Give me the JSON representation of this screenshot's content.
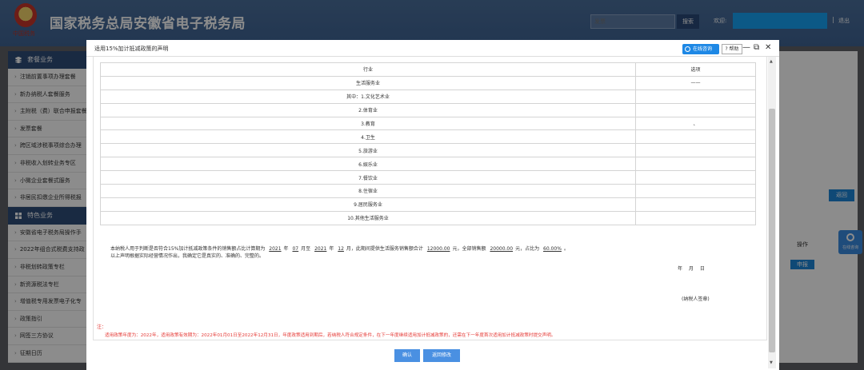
{
  "header": {
    "logo_motto": "中国税务",
    "title": "国家税务总局安徽省电子税务局",
    "search_placeholder": "发票",
    "search_button": "搜索",
    "welcome": "欢迎:",
    "separator": "|",
    "logout": "退出"
  },
  "sidebar": {
    "section1": "套餐业务",
    "section1_items": [
      "注销前置事项办理套餐",
      "新办纳税人套餐服务",
      "主附税（费）联合申报套餐",
      "发票套餐",
      "跨区域涉税事项综合办理",
      "非税收入划转业务专区",
      "小微企业套餐式服务",
      "非居民扣缴企业所得税报"
    ],
    "section2": "特色业务",
    "section2_items": [
      "安徽省电子税务局操作手",
      "2022年组合式税费支持政",
      "非税划转政策专栏",
      "新资源税法专栏",
      "增值税专用发票电子化专",
      "政策指引",
      "网签三方协议",
      "征期日历"
    ]
  },
  "background": {
    "back_button": "返回",
    "operation_header": "操作",
    "declare_button": "申报",
    "float_consult": "在线咨询"
  },
  "modal": {
    "title": "适用15%加计抵减政策的声明",
    "online_consult": "在线咨询",
    "help": "? 帮助",
    "minimize": "—",
    "restore": "⧉",
    "close": "✕",
    "table": {
      "headers": [
        "行业",
        "选项"
      ],
      "rows": [
        {
          "industry": "生活服务业",
          "option": "——"
        },
        {
          "industry": "其中：1.文化艺术业",
          "option": ""
        },
        {
          "industry": "2.体育业",
          "option": ""
        },
        {
          "industry": "3.教育",
          "option": "、"
        },
        {
          "industry": "4.卫生",
          "option": ""
        },
        {
          "industry": "5.旅游业",
          "option": ""
        },
        {
          "industry": "6.娱乐业",
          "option": ""
        },
        {
          "industry": "7.餐饮业",
          "option": ""
        },
        {
          "industry": "8.住宿业",
          "option": ""
        },
        {
          "industry": "9.居民服务业",
          "option": ""
        },
        {
          "industry": "10.其他生活服务业",
          "option": ""
        }
      ]
    },
    "statement": {
      "p1": "本纳税人用于判断是否符合15%加计抵减政策条件的销售额占比计算期为",
      "start_year": "2021",
      "t_year1": "年",
      "start_month": "07",
      "t_month_to": "月至",
      "end_year": "2021",
      "t_year2": "年",
      "end_month": "12",
      "p2": "月，此期间提供生活服务销售额合计",
      "service_sales": "12000.00",
      "p3": "元，全部销售额",
      "total_sales": "20000.00",
      "p4": "元，占比为",
      "ratio": "60.00%",
      "p5": "。",
      "line2": "以上声明根据实际经营情况作出，我确定它是真实的、准确的、完整的。"
    },
    "date_line": "年 月 日",
    "signature": "(纳税人签章)",
    "note_label": "注：",
    "note_text": "适用政策年度为：2022年，适用政策有效期为：2022年01月01日至2022年12月31日，年度政策适用到期后，若纳税人符合规定条件，在下一年度继续适用加计抵减政策的，还需在下一年度首次适用加计抵减政策时提交声明。",
    "confirm_button": "确认",
    "return_button": "返回修改"
  }
}
